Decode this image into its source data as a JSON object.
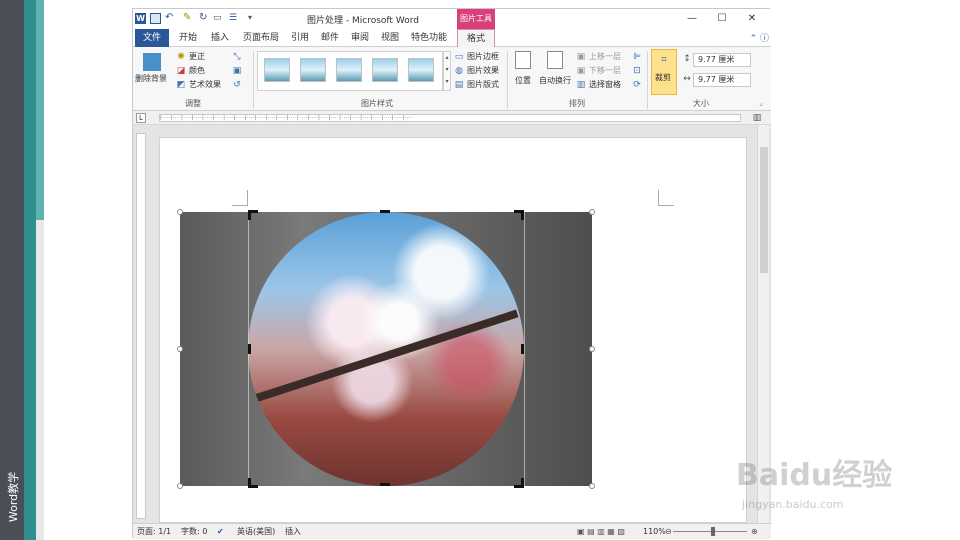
{
  "sidebar_caption": "Word教学",
  "window": {
    "title": "图片处理 - Microsoft Word",
    "context_tab": "图片工具"
  },
  "quick_access": {
    "app_icon": "W"
  },
  "tabs": [
    {
      "label": "文件"
    },
    {
      "label": "开始"
    },
    {
      "label": "插入"
    },
    {
      "label": "页面布局"
    },
    {
      "label": "引用"
    },
    {
      "label": "邮件"
    },
    {
      "label": "审阅"
    },
    {
      "label": "视图"
    },
    {
      "label": "特色功能"
    },
    {
      "label": "格式"
    }
  ],
  "ribbon": {
    "adjust": {
      "remove_bg": "删除背景",
      "corrections": "更正",
      "color": "颜色",
      "art_effects": "艺术效果",
      "label": "调整"
    },
    "styles": {
      "border": "图片边框",
      "effects": "图片效果",
      "layout": "图片版式",
      "label": "图片样式"
    },
    "arrange": {
      "position": "位置",
      "wrap": "自动换行",
      "bring_forward": "上移一层",
      "send_backward": "下移一层",
      "selection_pane": "选择窗格",
      "label": "排列"
    },
    "size": {
      "crop": "裁剪",
      "height": "9.77 厘米",
      "width": "9.77 厘米",
      "label": "大小"
    }
  },
  "statusbar": {
    "page": "页面: 1/1",
    "words": "字数: 0",
    "language": "英语(美国)",
    "mode": "插入",
    "zoom": "110%"
  },
  "watermark": {
    "logo": "Baidu经验",
    "url": "jingyan.baidu.com"
  }
}
